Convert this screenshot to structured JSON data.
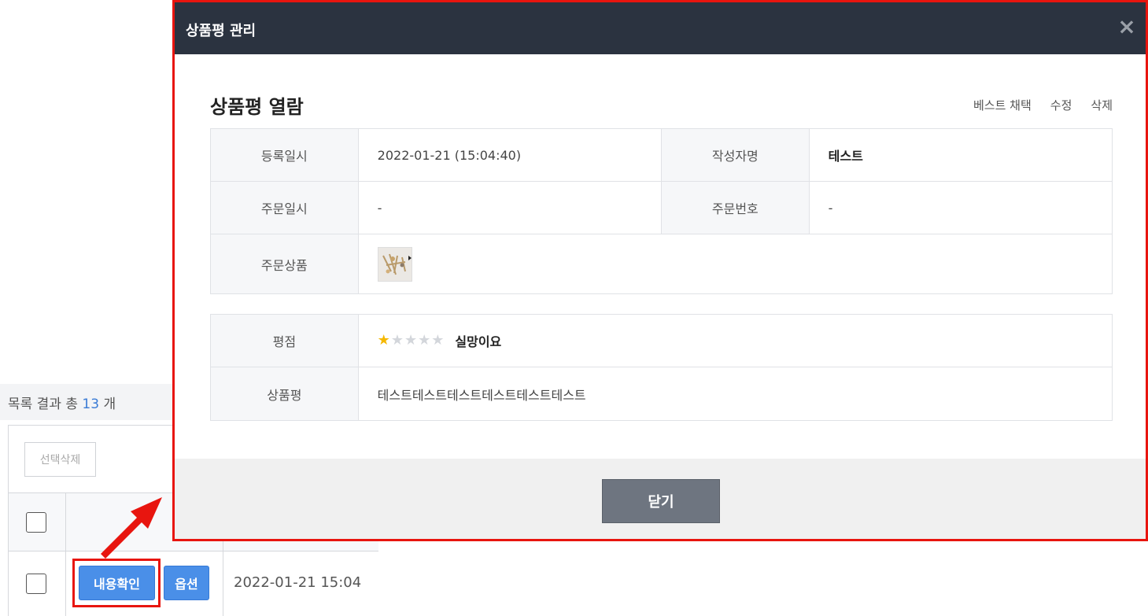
{
  "list": {
    "result_prefix": "목록 결과 총",
    "result_count": "13",
    "result_suffix": "개",
    "select_delete_label": "선택삭제",
    "row": {
      "view_button": "내용확인",
      "option_button": "옵션",
      "date": "2022-01-21 15:04"
    }
  },
  "modal": {
    "title": "상품평 관리",
    "close_symbol": "×",
    "section_title": "상품평 열람",
    "actions": [
      "베스트 채택",
      "수정",
      "삭제"
    ],
    "info": {
      "registered_label": "등록일시",
      "registered_value": "2022-01-21 (15:04:40)",
      "author_label": "작성자명",
      "author_value": "테스트",
      "order_date_label": "주문일시",
      "order_date_value": "-",
      "order_no_label": "주문번호",
      "order_no_value": "-",
      "order_product_label": "주문상품"
    },
    "review": {
      "rating_label": "평점",
      "rating_value": 1,
      "rating_max": 5,
      "rating_text": "실망이요",
      "content_label": "상품평",
      "content_value": "테스트테스트테스트테스트테스트테스트"
    },
    "footer_close_label": "닫기"
  },
  "colors": {
    "highlight": "#e8150f",
    "primary_button": "#4a8fe8",
    "header_bg": "#2b3340",
    "star_on": "#f5b800",
    "star_off": "#d3d6db"
  }
}
